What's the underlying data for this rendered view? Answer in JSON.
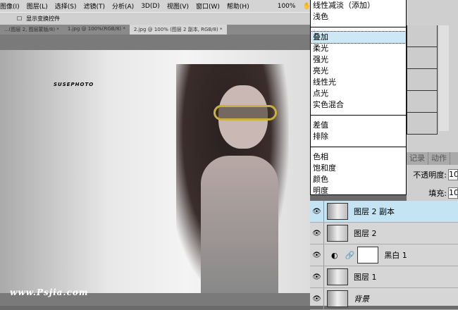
{
  "menu": [
    "图像(I)",
    "图层(L)",
    "选择(S)",
    "滤镜(T)",
    "分析(A)",
    "3D(D)",
    "视图(V)",
    "窗口(W)",
    "帮助(H)"
  ],
  "zoom_level": "100%",
  "options": {
    "show_transform": "显示变换控件"
  },
  "tabs": [
    "...(图层 2, 图层蒙版/8) *",
    "1.jpg @ 100%(RGB/8) *",
    "2.jpg @ 100% (图层 2 副本, RGB/8) *"
  ],
  "photo": {
    "logo": "SUSEPHOTO",
    "watermark": "www.Psjia.com"
  },
  "blend_menu": {
    "group1": [
      "线性减淡（添加）",
      "浅色"
    ],
    "group2": [
      "叠加",
      "柔光",
      "强光",
      "亮光",
      "线性光",
      "点光",
      "实色混合"
    ],
    "group3": [
      "差值",
      "排除"
    ],
    "group4": [
      "色相",
      "饱和度",
      "颜色",
      "明度"
    ],
    "selected": "叠加"
  },
  "panel_tabs": [
    "记录",
    "动作"
  ],
  "opacity": {
    "label": "不透明度:",
    "value": "10"
  },
  "fill": {
    "label": "填充:",
    "value": "10"
  },
  "layers": [
    {
      "name": "图层 2 副本",
      "active": true
    },
    {
      "name": "图层 2"
    },
    {
      "name": "黑白 1",
      "adjustment": true
    },
    {
      "name": "图层 1"
    },
    {
      "name": "背景",
      "italic": true
    }
  ]
}
